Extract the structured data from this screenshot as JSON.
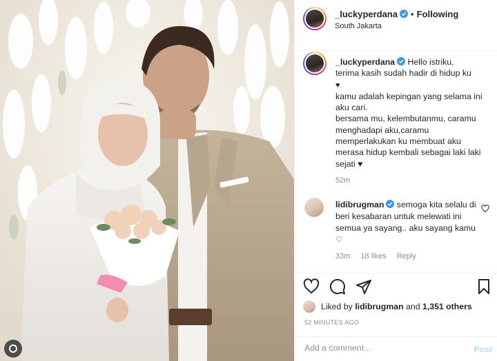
{
  "header": {
    "username": "_luckyperdana",
    "dot": "•",
    "follow_status": "Following",
    "location": "South Jakarta"
  },
  "caption": {
    "username": "_luckyperdana",
    "lines": [
      "Hello istriku,",
      "terima kasih sudah hadir di hidup ku",
      "♥",
      "kamu adalah kepingan yang selama ini aku cari.",
      "bersama mu, kelembutanmu, caramu menghadapi aku,caramu memperlakukan ku membuat aku merasa hidup kembali sebagai laki laki sejati ♥"
    ],
    "time": "52m"
  },
  "comment": {
    "username": "lidibrugman",
    "text": "semoga kita selalu di beri kesabaran untuk melewati ini semua ya sayang.. aku sayang kamu ♡",
    "time": "33m",
    "likes": "18 likes",
    "reply": "Reply"
  },
  "likes": {
    "prefix": "Liked by",
    "user": "lidibrugman",
    "and": "and",
    "others": "1,351 others"
  },
  "timestamp": "52 MINUTES AGO",
  "add_comment": {
    "placeholder": "Add a comment...",
    "post_label": "Post"
  },
  "colors": {
    "verified": "#3897f0",
    "post_button": "#b2dffc",
    "muted": "#8e8e8e"
  }
}
